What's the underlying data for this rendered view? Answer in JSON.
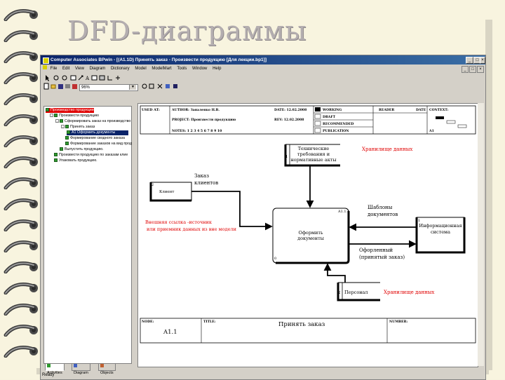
{
  "slide": {
    "title": "DFD-диаграммы"
  },
  "window": {
    "title": "Computer Associates BPwin - [(A1.1D) Принять заказ - Произвести продукцию [Для лекции.bp1]]",
    "menu": [
      "File",
      "Edit",
      "View",
      "Diagram",
      "Dictionary",
      "Model",
      "ModelMart",
      "Tools",
      "Window",
      "Help"
    ],
    "zoom": "96%",
    "status": "Ready"
  },
  "explorer": {
    "items": [
      {
        "label": "Производство продукции",
        "indent": 0,
        "state": "selected-red"
      },
      {
        "label": "Произвести продукцию",
        "indent": 1,
        "state": "normal"
      },
      {
        "label": "Сформировать заказ на производство",
        "indent": 2,
        "state": "normal"
      },
      {
        "label": "Принять заказ",
        "indent": 3,
        "state": "normal"
      },
      {
        "label": "A1 Оформить документы",
        "indent": 4,
        "state": "selected-blue"
      },
      {
        "label": "Формирование сводного заказа",
        "indent": 3,
        "state": "normal"
      },
      {
        "label": "Формирование заказов на вид прод",
        "indent": 3,
        "state": "normal"
      },
      {
        "label": "Выпустить продукцию.",
        "indent": 2,
        "state": "normal"
      },
      {
        "label": "Произвести продукцию по заказам клие",
        "indent": 1,
        "state": "normal"
      },
      {
        "label": "Упаковать продукцию.",
        "indent": 1,
        "state": "normal"
      }
    ],
    "tabs": [
      "Activities",
      "Diagram",
      "Objects"
    ]
  },
  "frame": {
    "used_at": "USED AT:",
    "author": "AUTHOR: Заналенко Н.В.",
    "project": "PROJECT: Произвести продукцию",
    "notes": "NOTES: 1 2 3 4 5 6 7 8 9 10",
    "date": "DATE: 12.02.2008",
    "rev": "REV: 12.02.2008",
    "working": "WORKING",
    "draft": "DRAFT",
    "recommended": "RECOMMENDED",
    "publication": "PUBLICATION",
    "reader": "READER",
    "date2": "DATE",
    "context": "CONTEXT:",
    "context_node": "A1",
    "node_label": "NODE:",
    "node_value": "A1.1",
    "title_label": "TITLE:",
    "title_value": "Принять заказ",
    "number_label": "NUMBER:"
  },
  "diagram": {
    "store1": {
      "number": "1",
      "line1": "Технические",
      "line2": "требования и",
      "line3": "нормативные акты"
    },
    "store1_note": "Хранилище данных",
    "entity_client": {
      "number": "2",
      "label": "Клиент"
    },
    "arrow_order": {
      "line1": "Заказ",
      "line2": "клиентов"
    },
    "external_note": {
      "line1": "Внешняя ссылка -источник",
      "line2": "или приемник данных из вне модели"
    },
    "process": {
      "code": "A1.1.4",
      "line1": "Оформить",
      "line2": "документы"
    },
    "arrow_templates": {
      "line1": "Шаблоны",
      "line2": "документов"
    },
    "info_system": {
      "number": "1",
      "line1": "Информационная",
      "line2": "система"
    },
    "arrow_done": {
      "line1": "Офорленный",
      "line2": "(принятый заказ)"
    },
    "store2": {
      "number": "2",
      "label": "Персонал"
    },
    "store2_note": "Хранилище данных",
    "process_id_mark": "0"
  },
  "colors": {
    "accent_red": "#e00000",
    "title_gray": "#b4aeb0",
    "titlebar_blue": "#0a246a"
  }
}
